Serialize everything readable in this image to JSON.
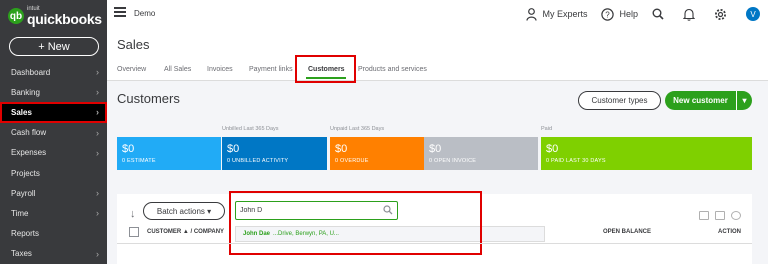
{
  "brand": {
    "intuit": "intuit",
    "name": "quickbooks",
    "mark": "qb"
  },
  "new_button": "+ New",
  "sidebar": {
    "items": [
      {
        "label": "Dashboard",
        "chevron": "›"
      },
      {
        "label": "Banking",
        "chevron": "›"
      },
      {
        "label": "Sales",
        "chevron": "›",
        "active": true
      },
      {
        "label": "Cash flow",
        "chevron": "›"
      },
      {
        "label": "Expenses",
        "chevron": "›"
      },
      {
        "label": "Projects",
        "chevron": ""
      },
      {
        "label": "Payroll",
        "chevron": "›"
      },
      {
        "label": "Time",
        "chevron": "›"
      },
      {
        "label": "Reports",
        "chevron": ""
      },
      {
        "label": "Taxes",
        "chevron": "›"
      }
    ]
  },
  "topbar": {
    "company": "Demo",
    "my_experts": "My Experts",
    "help": "Help",
    "avatar_initial": "V"
  },
  "section": {
    "title": "Sales"
  },
  "tabs": [
    "Overview",
    "All Sales",
    "Invoices",
    "Payment links",
    "Customers",
    "Products and services"
  ],
  "active_tab": "Customers",
  "page": {
    "title": "Customers"
  },
  "buttons": {
    "customer_types": "Customer types",
    "new_customer": "New customer",
    "new_customer_menu": "▾"
  },
  "money_bar": {
    "group_labels": {
      "unbilled": "Unbilled Last 365 Days",
      "unpaid": "Unpaid Last 365 Days",
      "paid": "Paid"
    },
    "cards": [
      {
        "amount": "$0",
        "label": "0 ESTIMATE",
        "color": "#21abf6"
      },
      {
        "amount": "$0",
        "label": "0 UNBILLED ACTIVITY",
        "color": "#0077c5"
      },
      {
        "amount": "$0",
        "label": "0 OVERDUE",
        "color": "#ff8000"
      },
      {
        "amount": "$0",
        "label": "0 OPEN INVOICE",
        "color": "#babec5"
      },
      {
        "amount": "$0",
        "label": "0 PAID LAST 30 DAYS",
        "color": "#7fd000"
      }
    ]
  },
  "table": {
    "batch_actions": "Batch actions",
    "search_value": "John D",
    "suggestion": {
      "name": "John Dae",
      "detail": "...Drive, Berwyn, PA, U..."
    },
    "headers": {
      "customer": "CUSTOMER ▲ / COMPANY",
      "open_balance": "OPEN BALANCE",
      "action": "ACTION"
    }
  },
  "colors": {
    "brand_green": "#2ca01c",
    "sidebar_bg": "#393a3d",
    "highlight_red": "#e00000"
  }
}
